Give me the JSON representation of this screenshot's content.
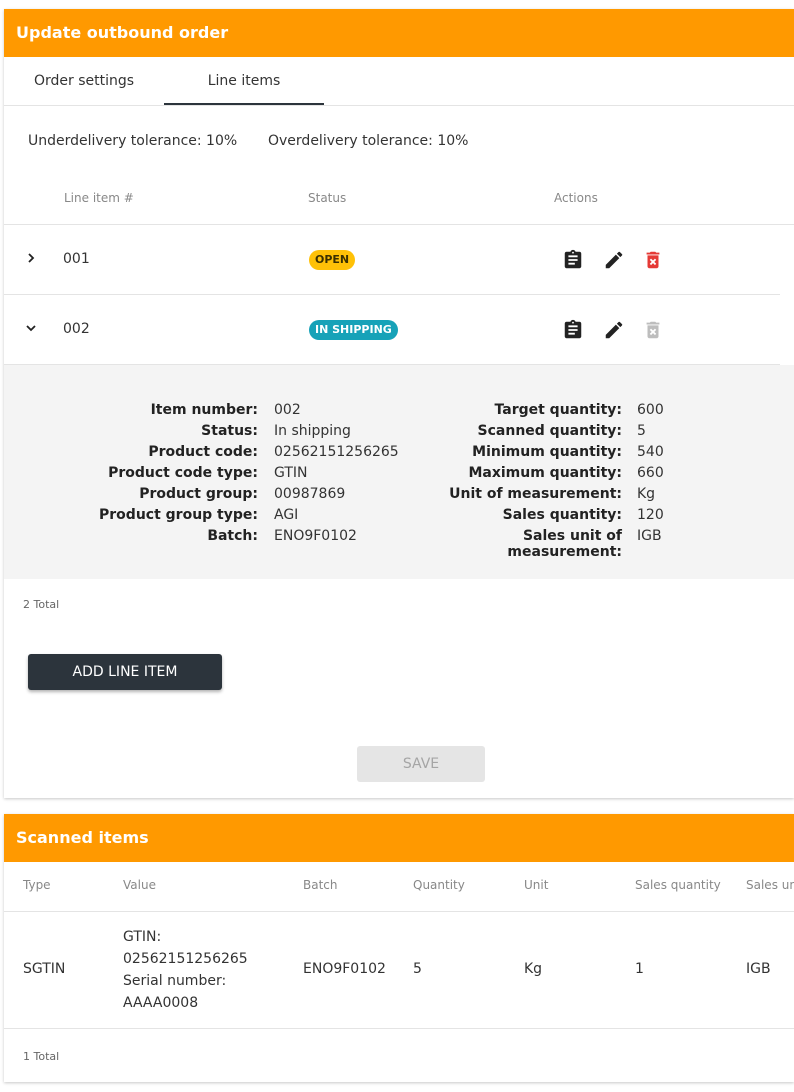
{
  "update_card": {
    "title": "Update outbound order",
    "tabs": [
      {
        "label": "Order settings",
        "active": false
      },
      {
        "label": "Line items",
        "active": true
      }
    ],
    "underdelivery": "Underdelivery tolerance: 10%",
    "overdelivery": "Overdelivery tolerance: 10%",
    "table_headers": {
      "line_item": "Line item #",
      "status": "Status",
      "actions": "Actions"
    },
    "rows": [
      {
        "number": "001",
        "status": "OPEN",
        "expanded": false,
        "delete_enabled": true
      },
      {
        "number": "002",
        "status": "IN SHIPPING",
        "expanded": true,
        "delete_enabled": false
      }
    ],
    "detail": {
      "left": [
        {
          "label": "Item number:",
          "value": "002"
        },
        {
          "label": "Status:",
          "value": "In shipping"
        },
        {
          "label": "Product code:",
          "value": "02562151256265"
        },
        {
          "label": "Product code type:",
          "value": "GTIN"
        },
        {
          "label": "Product group:",
          "value": "00987869"
        },
        {
          "label": "Product group type:",
          "value": "AGI"
        },
        {
          "label": "Batch:",
          "value": "ENO9F0102"
        }
      ],
      "right": [
        {
          "label": "Target quantity:",
          "value": "600"
        },
        {
          "label": "Scanned quantity:",
          "value": "5"
        },
        {
          "label": "Minimum quantity:",
          "value": "540"
        },
        {
          "label": "Maximum quantity:",
          "value": "660"
        },
        {
          "label": "Unit of measurement:",
          "value": "Kg"
        },
        {
          "label": "Sales quantity:",
          "value": "120"
        },
        {
          "label": "Sales unit of measurement:",
          "value": "IGB"
        }
      ]
    },
    "total": "2 Total",
    "add_button": "ADD LINE ITEM",
    "save_button": "SAVE"
  },
  "scanned_card": {
    "title": "Scanned items",
    "headers": [
      "Type",
      "Value",
      "Batch",
      "Quantity",
      "Unit",
      "Sales quantity",
      "Sales unit"
    ],
    "rows": [
      {
        "type": "SGTIN",
        "value_lines": [
          "GTIN:",
          "02562151256265",
          "Serial number:",
          "AAAA0008"
        ],
        "batch": "ENO9F0102",
        "quantity": "5",
        "unit": "Kg",
        "sales_quantity": "1",
        "sales_unit": "IGB"
      }
    ],
    "total": "1 Total"
  },
  "colors": {
    "header": "#ff9900",
    "open_badge": "#ffc107",
    "shipping_badge": "#17a2b8",
    "delete_active": "#e53935",
    "delete_disabled": "#bdbdbd",
    "dark_button": "#2c343c"
  },
  "icons": [
    "chevron-right-icon",
    "chevron-down-icon",
    "clipboard-icon",
    "pencil-icon",
    "delete-icon"
  ]
}
